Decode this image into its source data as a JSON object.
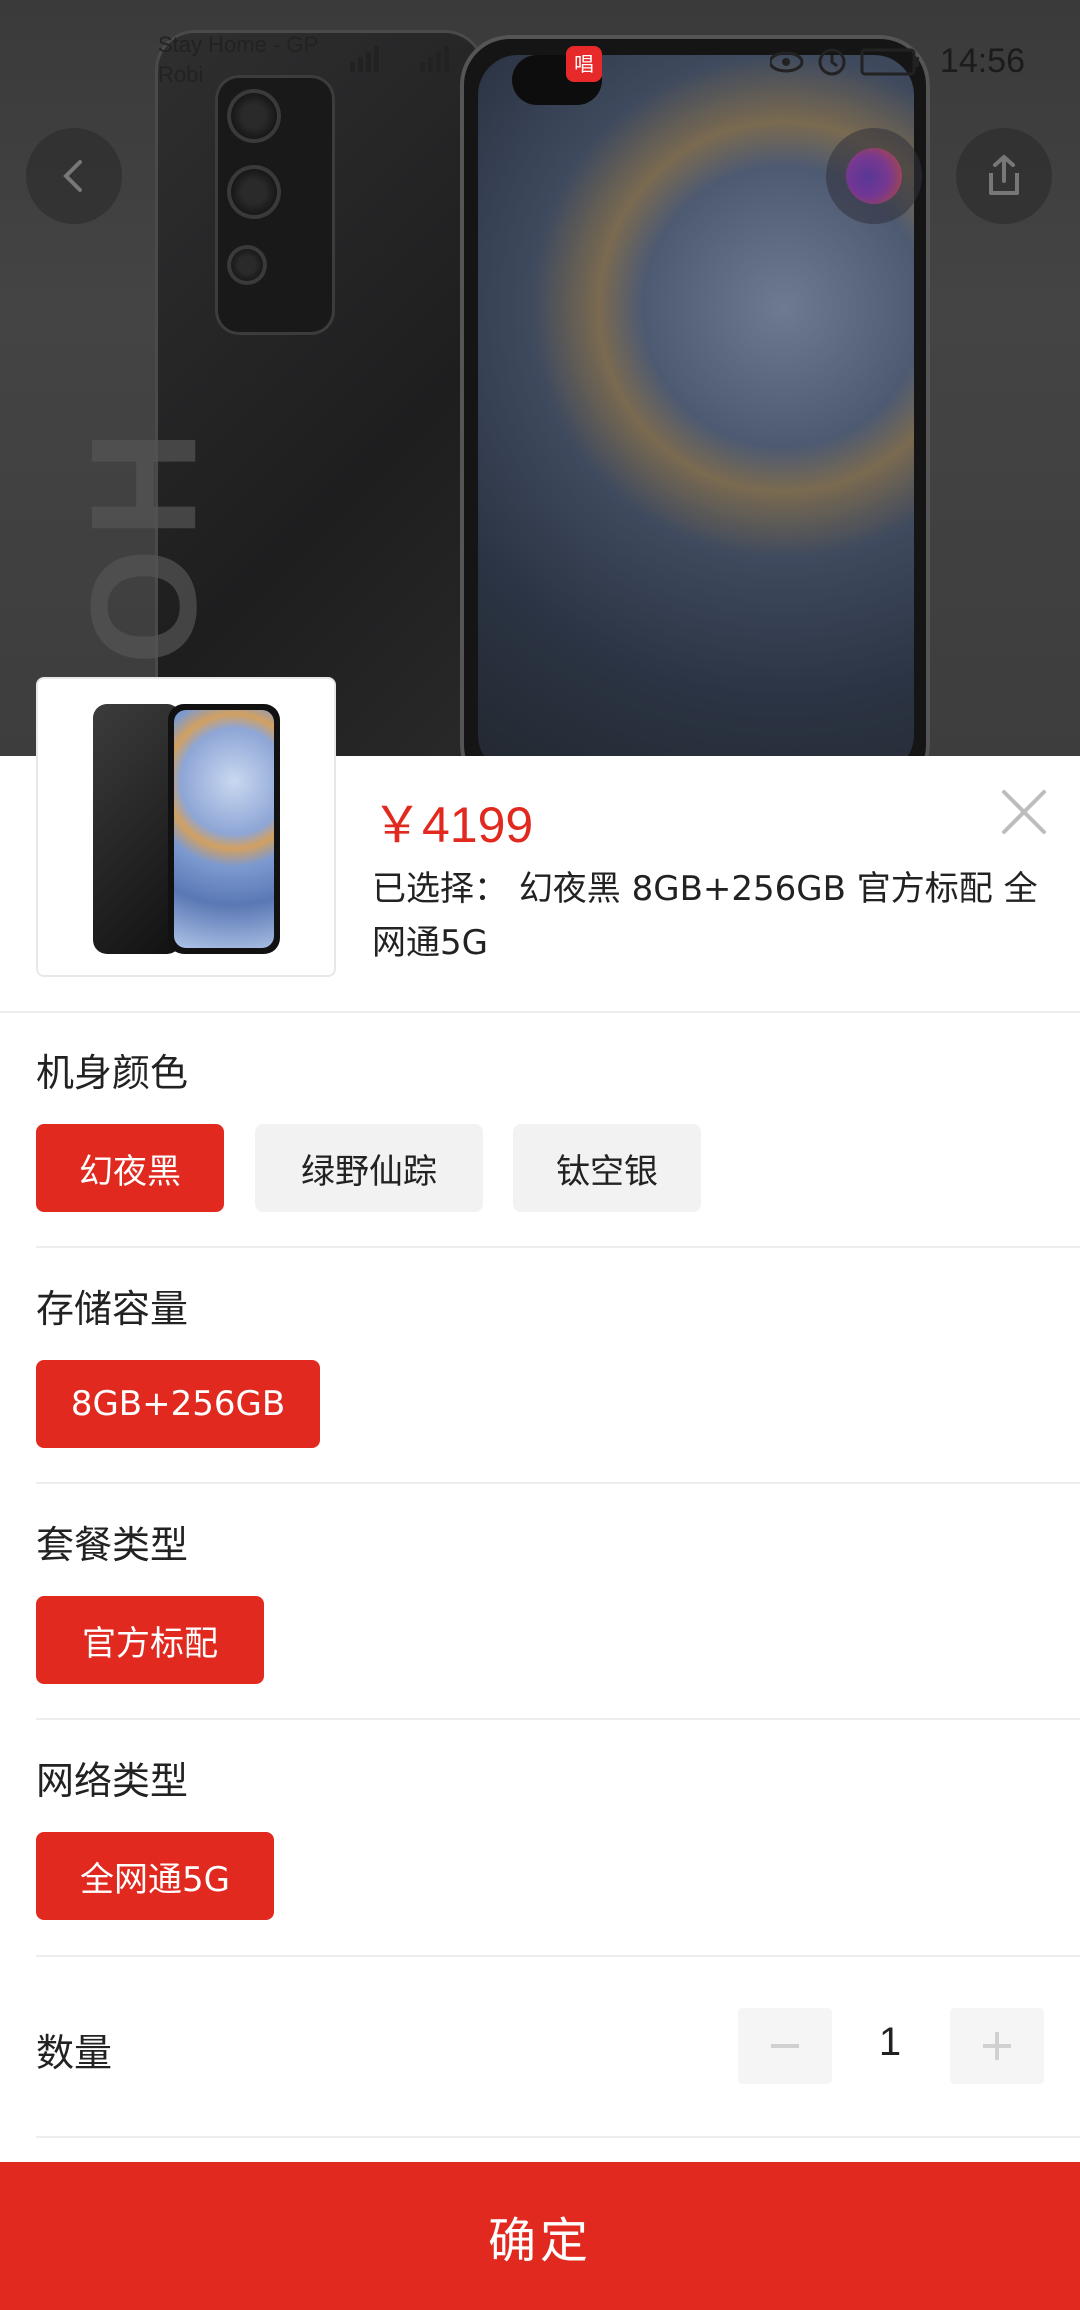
{
  "status_bar": {
    "carrier_line1": "Stay Home - GP",
    "carrier_line2": "Robi",
    "signal_text": "3G R    2G",
    "app_badge": "唱",
    "time": "14:56",
    "battery": "93"
  },
  "header": {
    "back_icon": "chevron-left-icon",
    "share_icon": "share-icon"
  },
  "sheet": {
    "price": "￥4199",
    "selected_label": "已选择：",
    "selected_value": "幻夜黑 8GB+256GB 官方标配 全网通5G",
    "groups": [
      {
        "title": "机身颜色",
        "options": [
          "幻夜黑",
          "绿野仙踪",
          "钛空银"
        ],
        "selected": 0
      },
      {
        "title": "存储容量",
        "options": [
          "8GB+256GB"
        ],
        "selected": 0
      },
      {
        "title": "套餐类型",
        "options": [
          "官方标配"
        ],
        "selected": 0
      },
      {
        "title": "网络类型",
        "options": [
          "全网通5G"
        ],
        "selected": 0
      }
    ],
    "quantity_label": "数量",
    "quantity_value": "1",
    "confirm_label": "确定"
  },
  "colors": {
    "accent": "#e1291f",
    "chip_bg": "#f2f2f2"
  }
}
